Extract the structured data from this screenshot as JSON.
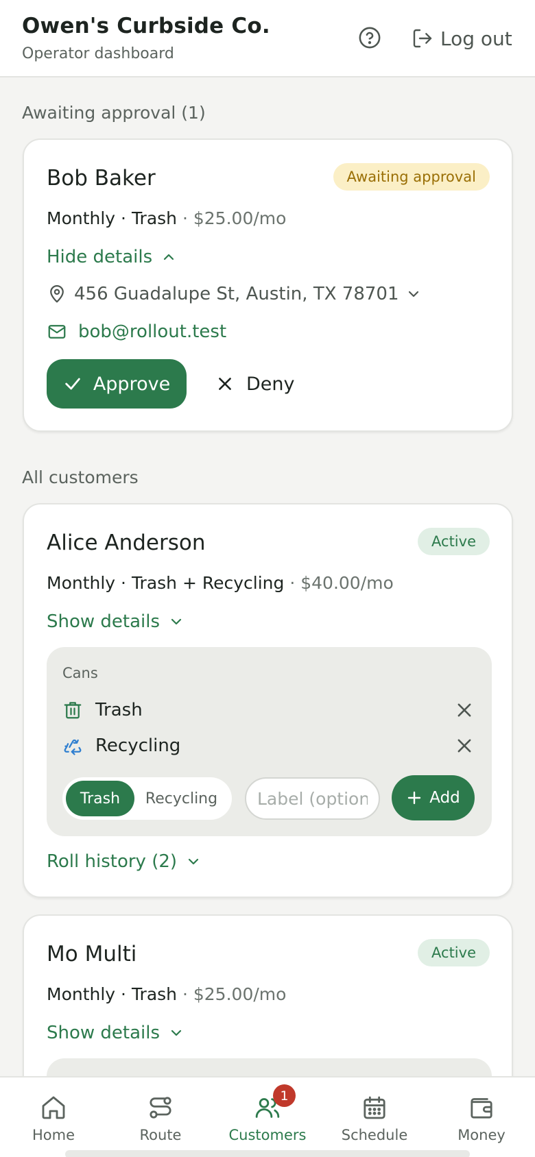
{
  "header": {
    "title": "Owen's Curbside Co.",
    "subtitle": "Operator dashboard",
    "help_icon": "help-circle-icon",
    "logout_label": "Log out",
    "logout_icon": "logout-icon"
  },
  "pending_section": {
    "label": "Awaiting approval (1)",
    "customer": {
      "name": "Bob Baker",
      "status": "Awaiting approval",
      "frequency": "Monthly",
      "service": "Trash",
      "price": "$25.00/mo",
      "details_toggle": "Hide details",
      "address": "456 Guadalupe St, Austin, TX 78701",
      "email": "bob@rollout.test",
      "approve_label": "Approve",
      "deny_label": "Deny"
    }
  },
  "customers_section": {
    "label": "All customers",
    "customers": [
      {
        "name": "Alice Anderson",
        "status": "Active",
        "frequency": "Monthly",
        "service": "Trash + Recycling",
        "price": "$40.00/mo",
        "details_toggle": "Show details",
        "cans": {
          "title": "Cans",
          "items": [
            {
              "label": "Trash",
              "icon": "trash-can-icon"
            },
            {
              "label": "Recycling",
              "icon": "recycle-icon"
            }
          ],
          "type_options": [
            "Trash",
            "Recycling"
          ],
          "selected_type": "Trash",
          "label_placeholder": "Label (optional)",
          "add_label": "Add"
        },
        "roll_history_label": "Roll history (2)"
      },
      {
        "name": "Mo Multi",
        "status": "Active",
        "frequency": "Monthly",
        "service": "Trash",
        "price": "$25.00/mo",
        "details_toggle": "Show details"
      }
    ]
  },
  "bottom_nav": {
    "items": [
      {
        "label": "Home",
        "icon": "home-icon"
      },
      {
        "label": "Route",
        "icon": "route-icon"
      },
      {
        "label": "Customers",
        "icon": "users-icon",
        "badge": "1",
        "active": true
      },
      {
        "label": "Schedule",
        "icon": "calendar-icon"
      },
      {
        "label": "Money",
        "icon": "wallet-icon"
      }
    ]
  },
  "colors": {
    "primary": "#2c7a4c",
    "pending_badge_bg": "#fbefc6",
    "pending_badge_text": "#9a6f06",
    "active_badge_bg": "#e1efe5",
    "notification_badge": "#c0392b",
    "page_bg": "#f4f4f2"
  }
}
